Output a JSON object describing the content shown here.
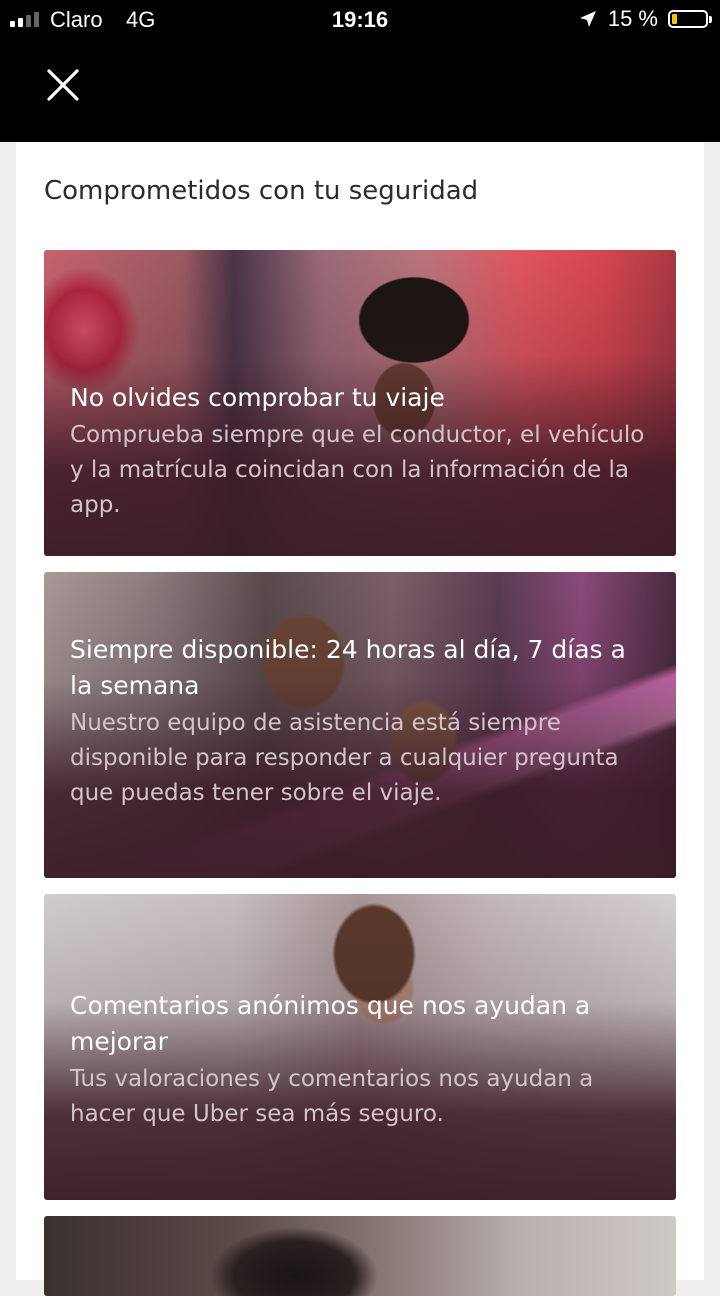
{
  "status_bar": {
    "carrier": "Claro",
    "network": "4G",
    "time": "19:16",
    "battery_text": "15 %",
    "battery_level": 0.15
  },
  "header": {
    "close_icon": "close-icon"
  },
  "page": {
    "title": "Comprometidos con tu seguridad"
  },
  "cards": [
    {
      "title": "No olvides comprobar tu viaje",
      "body": "Comprueba siempre que el conductor, el vehículo y la matrícula coincidan con la información de la app."
    },
    {
      "title": "Siempre disponible: 24 horas al día, 7 días a la semana",
      "body": "Nuestro equipo de asistencia está siempre disponible para responder a cualquier pregunta que puedas tener sobre el viaje."
    },
    {
      "title": "Comentarios anónimos que nos ayudan a mejorar",
      "body": "Tus valoraciones y comentarios nos ayudan a hacer que Uber sea más seguro."
    }
  ],
  "colors": {
    "battery": "#f5c400",
    "card_overlay": "#3a1c28"
  }
}
